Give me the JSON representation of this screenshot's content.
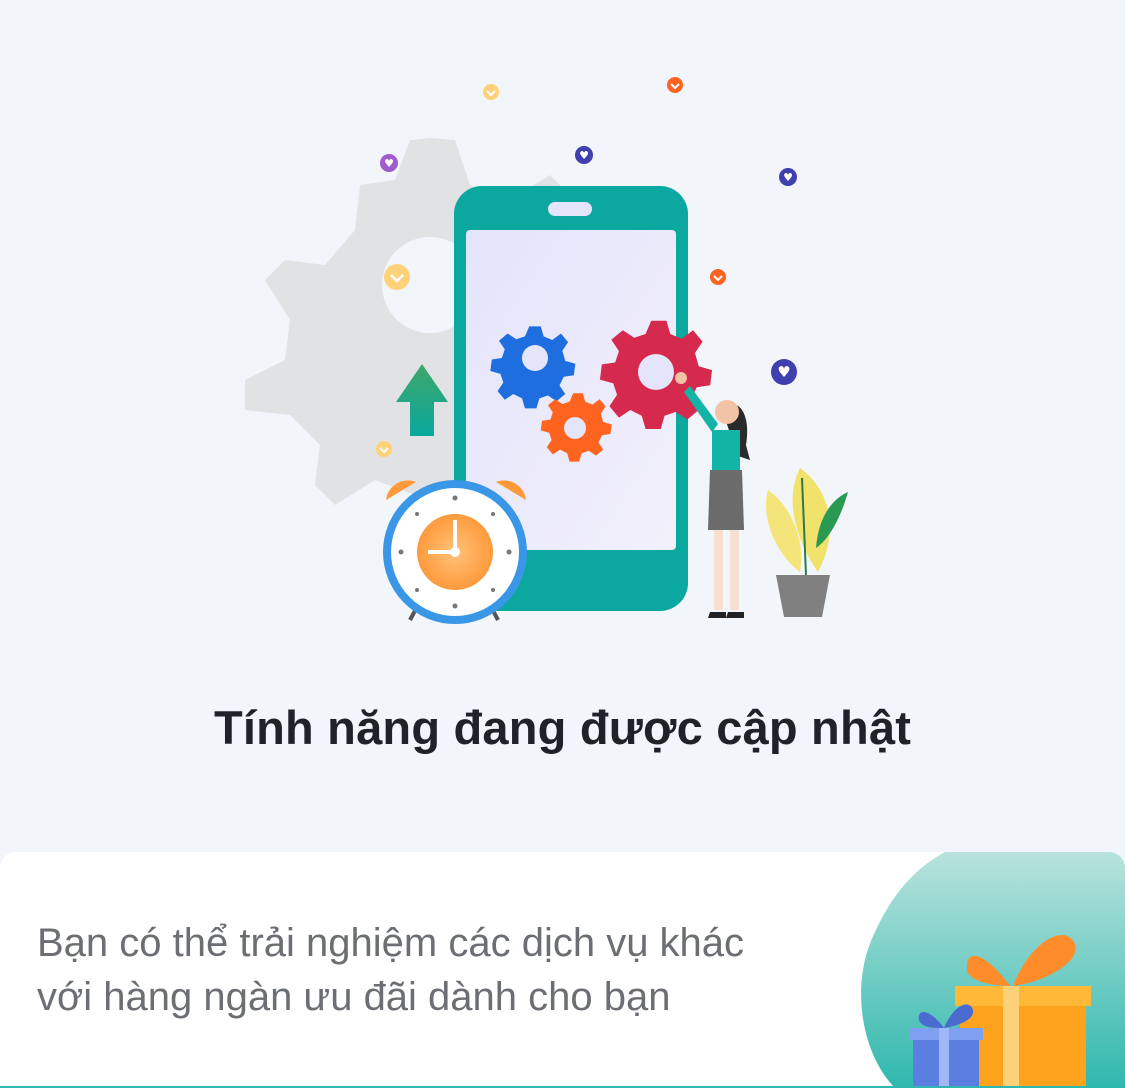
{
  "empty_state": {
    "title": "Tính năng đang được cập nhật",
    "illustration_icon": "app-update-gears-illustration"
  },
  "promo": {
    "line1": "Bạn có thể trải nghiệm các dịch vụ khác",
    "line2": "với hàng ngàn ưu đãi dành cho bạn",
    "icon": "gift-box-icon"
  },
  "colors": {
    "background": "#f2f5f9",
    "phone": "#0aa89e",
    "title_text": "#1f2329",
    "promo_text": "#6b6e73",
    "accent_teal": "#2fb8ad"
  }
}
